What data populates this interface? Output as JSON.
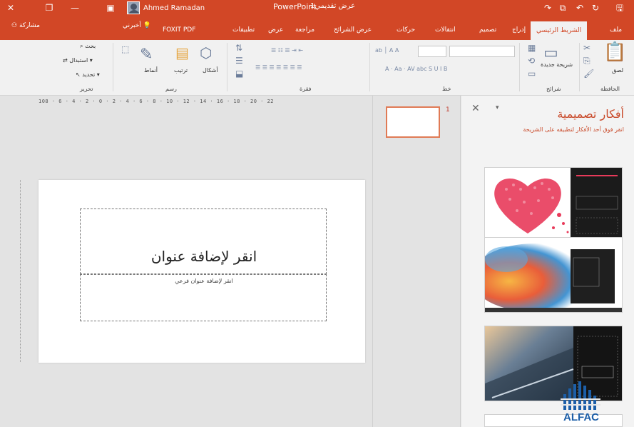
{
  "titlebar": {
    "user_name": "Ahmed Ramadan",
    "app_name": "PowerPoint",
    "doc_name": "عرض تقديمي1",
    "accent": "#d24726"
  },
  "tabs": [
    {
      "label": "ملف"
    },
    {
      "label": "الشريط الرئيسي"
    },
    {
      "label": "إدراج"
    },
    {
      "label": "تصميم"
    },
    {
      "label": "انتقالات"
    },
    {
      "label": "حركات"
    },
    {
      "label": "عرض الشرائح"
    },
    {
      "label": "مراجعة"
    },
    {
      "label": "عرض"
    },
    {
      "label": "تطبيقات"
    },
    {
      "label": "FOXIT PDF"
    }
  ],
  "tell_me": "أخبرني",
  "share": "مشاركة",
  "ribbon": {
    "groups": {
      "clipboard": "الحافظة",
      "slides": "شرائح",
      "font": "خط",
      "paragraph": "فقرة",
      "drawing": "رسم",
      "editing": "تحرير"
    },
    "paste_label": "لصق",
    "new_slide_label": "شريحة جديدة",
    "shapes_label": "أشكال",
    "arrange_label": "ترتيب",
    "quick_styles_label": "أنماط",
    "find_label": "بحث",
    "replace_label": "استبدال",
    "select_label": "تحديد"
  },
  "ruler_text": "108 · 6 · 4 · 2 · 0 · 2 · 4 · 6 · 8 · 10 · 12 · 14 · 16 · 18 · 20 · 22",
  "slide": {
    "title_placeholder": "انقر لإضافة عنوان",
    "subtitle_placeholder": "انقر لإضافة عنوان فرعي"
  },
  "thumbnail": {
    "number": "1"
  },
  "design_ideas": {
    "title": "أفكار تصميمية",
    "subtitle": "انقر فوق أحد الأفكار لتطبيقه على الشريحة",
    "accent": "#c94a2a"
  },
  "watermark": "ALFAC"
}
